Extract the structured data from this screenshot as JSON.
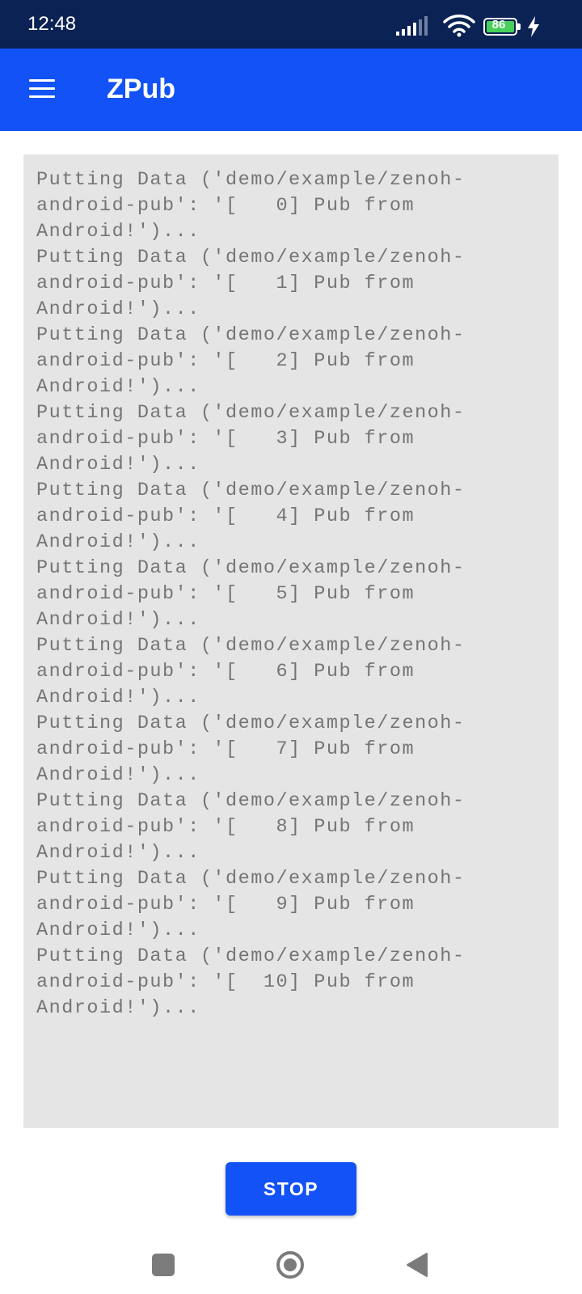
{
  "status_bar": {
    "time": "12:48",
    "battery_level": "86",
    "icons": [
      "signal-icon",
      "wifi-icon",
      "battery-icon",
      "charging-icon"
    ]
  },
  "app_bar": {
    "title": "ZPub",
    "menu_icon": "menu-icon"
  },
  "log": {
    "lines": [
      "Putting Data ('demo/example/zenoh-android-pub': '[   0] Pub from Android!')...",
      "Putting Data ('demo/example/zenoh-android-pub': '[   1] Pub from Android!')...",
      "Putting Data ('demo/example/zenoh-android-pub': '[   2] Pub from Android!')...",
      "Putting Data ('demo/example/zenoh-android-pub': '[   3] Pub from Android!')...",
      "Putting Data ('demo/example/zenoh-android-pub': '[   4] Pub from Android!')...",
      "Putting Data ('demo/example/zenoh-android-pub': '[   5] Pub from Android!')...",
      "Putting Data ('demo/example/zenoh-android-pub': '[   6] Pub from Android!')...",
      "Putting Data ('demo/example/zenoh-android-pub': '[   7] Pub from Android!')...",
      "Putting Data ('demo/example/zenoh-android-pub': '[   8] Pub from Android!')...",
      "Putting Data ('demo/example/zenoh-android-pub': '[   9] Pub from Android!')...",
      "Putting Data ('demo/example/zenoh-android-pub': '[  10] Pub from Android!')..."
    ]
  },
  "actions": {
    "stop_label": "STOP"
  },
  "nav_bar": {
    "icons": [
      "recents-square-icon",
      "home-circle-icon",
      "back-triangle-icon"
    ]
  },
  "colors": {
    "status_bar_bg": "#0b2254",
    "primary": "#1252f6",
    "log_bg": "#e5e5e5",
    "log_text": "#757575",
    "battery_fill": "#47d15b"
  }
}
